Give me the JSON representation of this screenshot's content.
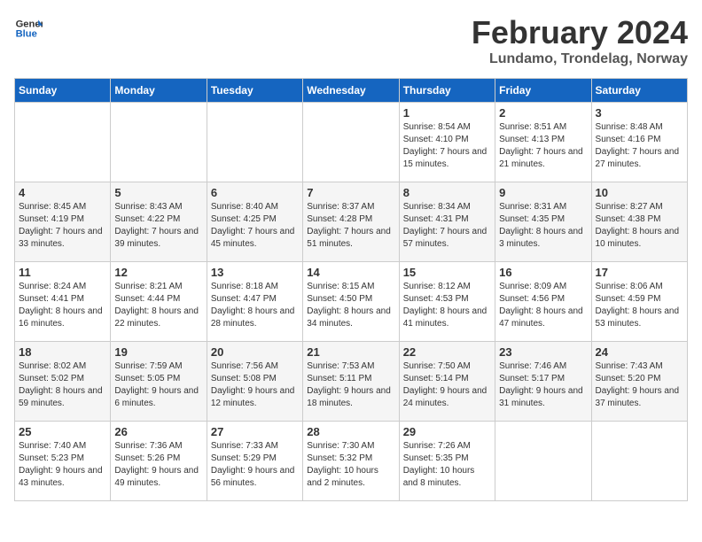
{
  "header": {
    "logo_line1": "General",
    "logo_line2": "Blue",
    "month_title": "February 2024",
    "location": "Lundamo, Trondelag, Norway"
  },
  "weekdays": [
    "Sunday",
    "Monday",
    "Tuesday",
    "Wednesday",
    "Thursday",
    "Friday",
    "Saturday"
  ],
  "weeks": [
    [
      {
        "day": "",
        "sunrise": "",
        "sunset": "",
        "daylight": ""
      },
      {
        "day": "",
        "sunrise": "",
        "sunset": "",
        "daylight": ""
      },
      {
        "day": "",
        "sunrise": "",
        "sunset": "",
        "daylight": ""
      },
      {
        "day": "",
        "sunrise": "",
        "sunset": "",
        "daylight": ""
      },
      {
        "day": "1",
        "sunrise": "Sunrise: 8:54 AM",
        "sunset": "Sunset: 4:10 PM",
        "daylight": "Daylight: 7 hours and 15 minutes."
      },
      {
        "day": "2",
        "sunrise": "Sunrise: 8:51 AM",
        "sunset": "Sunset: 4:13 PM",
        "daylight": "Daylight: 7 hours and 21 minutes."
      },
      {
        "day": "3",
        "sunrise": "Sunrise: 8:48 AM",
        "sunset": "Sunset: 4:16 PM",
        "daylight": "Daylight: 7 hours and 27 minutes."
      }
    ],
    [
      {
        "day": "4",
        "sunrise": "Sunrise: 8:45 AM",
        "sunset": "Sunset: 4:19 PM",
        "daylight": "Daylight: 7 hours and 33 minutes."
      },
      {
        "day": "5",
        "sunrise": "Sunrise: 8:43 AM",
        "sunset": "Sunset: 4:22 PM",
        "daylight": "Daylight: 7 hours and 39 minutes."
      },
      {
        "day": "6",
        "sunrise": "Sunrise: 8:40 AM",
        "sunset": "Sunset: 4:25 PM",
        "daylight": "Daylight: 7 hours and 45 minutes."
      },
      {
        "day": "7",
        "sunrise": "Sunrise: 8:37 AM",
        "sunset": "Sunset: 4:28 PM",
        "daylight": "Daylight: 7 hours and 51 minutes."
      },
      {
        "day": "8",
        "sunrise": "Sunrise: 8:34 AM",
        "sunset": "Sunset: 4:31 PM",
        "daylight": "Daylight: 7 hours and 57 minutes."
      },
      {
        "day": "9",
        "sunrise": "Sunrise: 8:31 AM",
        "sunset": "Sunset: 4:35 PM",
        "daylight": "Daylight: 8 hours and 3 minutes."
      },
      {
        "day": "10",
        "sunrise": "Sunrise: 8:27 AM",
        "sunset": "Sunset: 4:38 PM",
        "daylight": "Daylight: 8 hours and 10 minutes."
      }
    ],
    [
      {
        "day": "11",
        "sunrise": "Sunrise: 8:24 AM",
        "sunset": "Sunset: 4:41 PM",
        "daylight": "Daylight: 8 hours and 16 minutes."
      },
      {
        "day": "12",
        "sunrise": "Sunrise: 8:21 AM",
        "sunset": "Sunset: 4:44 PM",
        "daylight": "Daylight: 8 hours and 22 minutes."
      },
      {
        "day": "13",
        "sunrise": "Sunrise: 8:18 AM",
        "sunset": "Sunset: 4:47 PM",
        "daylight": "Daylight: 8 hours and 28 minutes."
      },
      {
        "day": "14",
        "sunrise": "Sunrise: 8:15 AM",
        "sunset": "Sunset: 4:50 PM",
        "daylight": "Daylight: 8 hours and 34 minutes."
      },
      {
        "day": "15",
        "sunrise": "Sunrise: 8:12 AM",
        "sunset": "Sunset: 4:53 PM",
        "daylight": "Daylight: 8 hours and 41 minutes."
      },
      {
        "day": "16",
        "sunrise": "Sunrise: 8:09 AM",
        "sunset": "Sunset: 4:56 PM",
        "daylight": "Daylight: 8 hours and 47 minutes."
      },
      {
        "day": "17",
        "sunrise": "Sunrise: 8:06 AM",
        "sunset": "Sunset: 4:59 PM",
        "daylight": "Daylight: 8 hours and 53 minutes."
      }
    ],
    [
      {
        "day": "18",
        "sunrise": "Sunrise: 8:02 AM",
        "sunset": "Sunset: 5:02 PM",
        "daylight": "Daylight: 8 hours and 59 minutes."
      },
      {
        "day": "19",
        "sunrise": "Sunrise: 7:59 AM",
        "sunset": "Sunset: 5:05 PM",
        "daylight": "Daylight: 9 hours and 6 minutes."
      },
      {
        "day": "20",
        "sunrise": "Sunrise: 7:56 AM",
        "sunset": "Sunset: 5:08 PM",
        "daylight": "Daylight: 9 hours and 12 minutes."
      },
      {
        "day": "21",
        "sunrise": "Sunrise: 7:53 AM",
        "sunset": "Sunset: 5:11 PM",
        "daylight": "Daylight: 9 hours and 18 minutes."
      },
      {
        "day": "22",
        "sunrise": "Sunrise: 7:50 AM",
        "sunset": "Sunset: 5:14 PM",
        "daylight": "Daylight: 9 hours and 24 minutes."
      },
      {
        "day": "23",
        "sunrise": "Sunrise: 7:46 AM",
        "sunset": "Sunset: 5:17 PM",
        "daylight": "Daylight: 9 hours and 31 minutes."
      },
      {
        "day": "24",
        "sunrise": "Sunrise: 7:43 AM",
        "sunset": "Sunset: 5:20 PM",
        "daylight": "Daylight: 9 hours and 37 minutes."
      }
    ],
    [
      {
        "day": "25",
        "sunrise": "Sunrise: 7:40 AM",
        "sunset": "Sunset: 5:23 PM",
        "daylight": "Daylight: 9 hours and 43 minutes."
      },
      {
        "day": "26",
        "sunrise": "Sunrise: 7:36 AM",
        "sunset": "Sunset: 5:26 PM",
        "daylight": "Daylight: 9 hours and 49 minutes."
      },
      {
        "day": "27",
        "sunrise": "Sunrise: 7:33 AM",
        "sunset": "Sunset: 5:29 PM",
        "daylight": "Daylight: 9 hours and 56 minutes."
      },
      {
        "day": "28",
        "sunrise": "Sunrise: 7:30 AM",
        "sunset": "Sunset: 5:32 PM",
        "daylight": "Daylight: 10 hours and 2 minutes."
      },
      {
        "day": "29",
        "sunrise": "Sunrise: 7:26 AM",
        "sunset": "Sunset: 5:35 PM",
        "daylight": "Daylight: 10 hours and 8 minutes."
      },
      {
        "day": "",
        "sunrise": "",
        "sunset": "",
        "daylight": ""
      },
      {
        "day": "",
        "sunrise": "",
        "sunset": "",
        "daylight": ""
      }
    ]
  ]
}
